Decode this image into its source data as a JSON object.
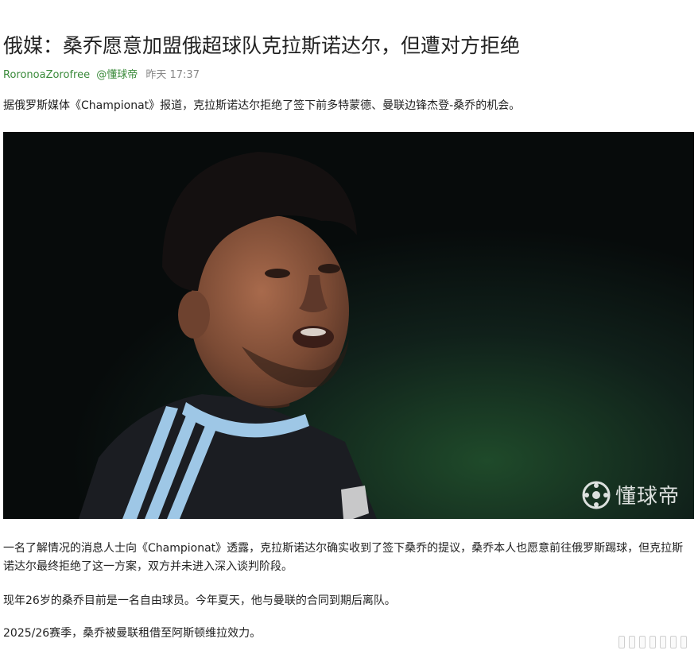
{
  "article": {
    "title": "俄媒：桑乔愿意加盟俄超球队克拉斯诺达尔，但遭对方拒绝",
    "author": "RoronoaZorofree",
    "source": "@懂球帝",
    "time": "昨天 17:37",
    "paragraphs": [
      "据俄罗斯媒体《Championat》报道，克拉斯诺达尔拒绝了签下前多特蒙德、曼联边锋杰登-桑乔的机会。",
      "一名了解情况的消息人士向《Championat》透露，克拉斯诺达尔确实收到了签下桑乔的提议，桑乔本人也愿意前往俄罗斯踢球，但克拉斯诺达尔最终拒绝了这一方案，双方并未进入深入谈判阶段。",
      "现年26岁的桑乔目前是一名自由球员。今年夏天，他与曼联的合同到期后离队。",
      "2025/26赛季，桑乔被曼联租借至阿斯顿维拉效力。"
    ]
  },
  "photo": {
    "watermark_text": "懂球帝",
    "watermark_icon": "dongqiudi-logo-icon",
    "background_color": "#0b1312",
    "jersey_color": "#1b1d22",
    "stripe_color": "#9ec7e6"
  },
  "footer": {
    "more_icon": "more-dots-icon"
  }
}
